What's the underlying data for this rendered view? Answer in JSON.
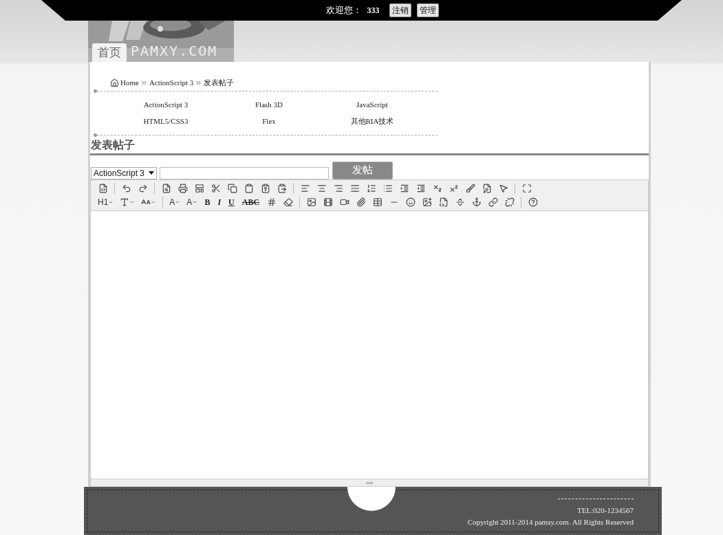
{
  "header": {
    "welcome": "欢迎您：",
    "username": "333",
    "buttons": [
      "注销",
      "管理"
    ]
  },
  "banner": {
    "home_tab": "首页",
    "logo_text": "PAMXY.COM"
  },
  "breadcrumb": [
    "Home",
    "ActionScript 3",
    "发表帖子"
  ],
  "categories": [
    "ActionScript 3",
    "Flash 3D",
    "JavaScript",
    "HTML5/CSS3",
    "Flex",
    "其他RIA技术"
  ],
  "page_title": "发表帖子",
  "post_form": {
    "category": "ActionScript 3",
    "submit": "发帖"
  },
  "toolbar": {
    "rows": [
      [
        {
          "kind": "icon"
        },
        {
          "kind": "separator"
        },
        {
          "kind": "icon"
        },
        {
          "kind": "icon"
        },
        {
          "kind": "separator"
        },
        {
          "kind": "icon"
        },
        {
          "kind": "icon"
        },
        {
          "kind": "icon"
        },
        {
          "kind": "icon"
        },
        {
          "kind": "icon"
        },
        {
          "kind": "icon"
        },
        {
          "kind": "icon"
        },
        {
          "kind": "icon"
        },
        {
          "kind": "separator"
        },
        {
          "kind": "icon"
        },
        {
          "kind": "icon"
        },
        {
          "kind": "icon"
        },
        {
          "kind": "icon"
        },
        {
          "kind": "icon"
        },
        {
          "kind": "icon"
        },
        {
          "kind": "icon"
        },
        {
          "kind": "icon"
        },
        {
          "kind": "icon"
        },
        {
          "kind": "icon"
        },
        {
          "kind": "icon"
        },
        {
          "kind": "icon"
        },
        {
          "kind": "icon"
        },
        {
          "kind": "separator"
        },
        {
          "kind": "icon"
        }
      ],
      [
        {
          "kind": "text_dropdown",
          "label": "H1"
        },
        {
          "kind": "icon_dropdown"
        },
        {
          "kind": "icon_dropdown"
        },
        {
          "kind": "separator"
        },
        {
          "kind": "text_dropdown",
          "label": "A"
        },
        {
          "kind": "text_dropdown",
          "label": "A"
        },
        {
          "kind": "text",
          "label": "B"
        },
        {
          "kind": "text",
          "label": "I"
        },
        {
          "kind": "text",
          "label": "U"
        },
        {
          "kind": "text",
          "label": "ABC"
        },
        {
          "kind": "icon"
        },
        {
          "kind": "icon"
        },
        {
          "kind": "separator"
        },
        {
          "kind": "icon"
        },
        {
          "kind": "icon"
        },
        {
          "kind": "icon"
        },
        {
          "kind": "icon"
        },
        {
          "kind": "icon"
        },
        {
          "kind": "icon"
        },
        {
          "kind": "icon"
        },
        {
          "kind": "icon"
        },
        {
          "kind": "icon"
        },
        {
          "kind": "icon"
        },
        {
          "kind": "icon"
        },
        {
          "kind": "icon"
        },
        {
          "kind": "icon"
        },
        {
          "kind": "separator"
        },
        {
          "kind": "icon"
        }
      ]
    ]
  },
  "footer": {
    "tel": "TEL:020-1234567",
    "copyright": "Copyright 2011-2014 pamsy.com. All Rights Reserved"
  }
}
